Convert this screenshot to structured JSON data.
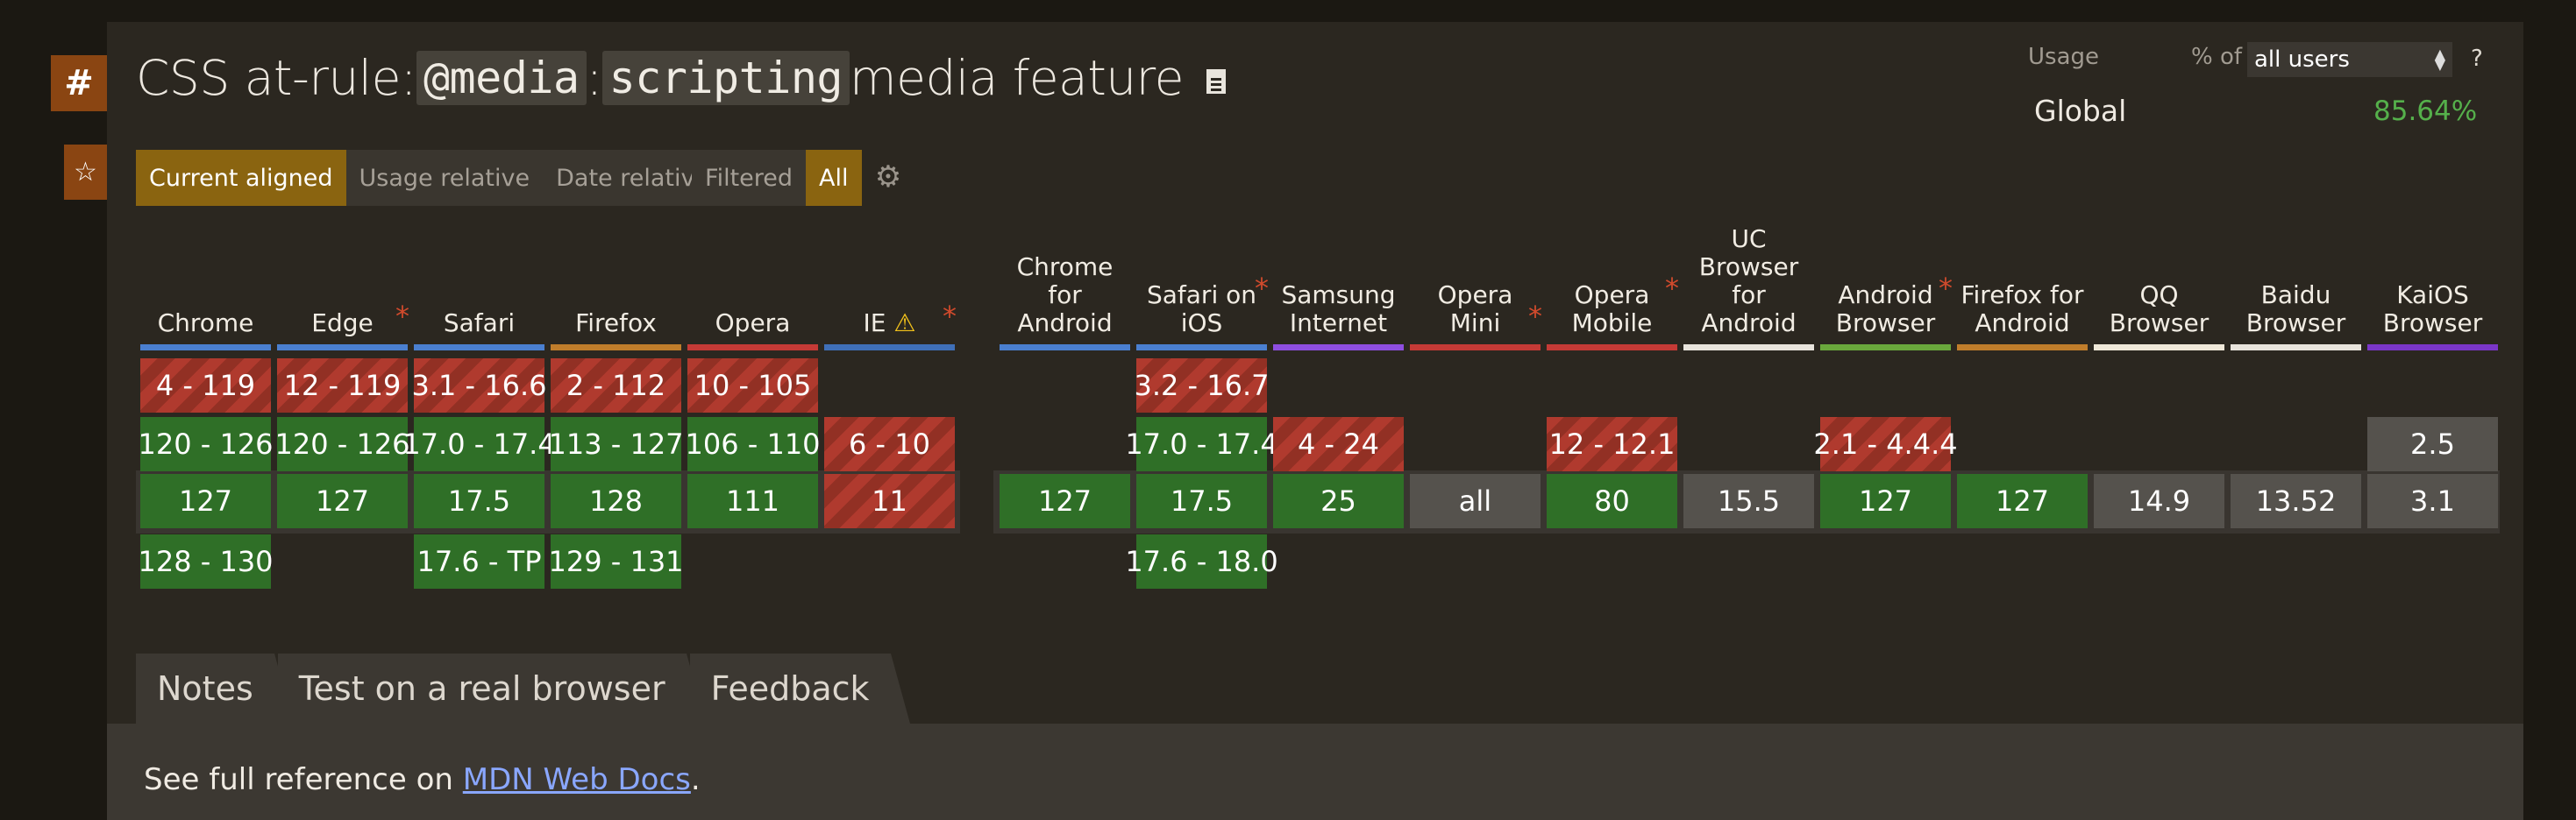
{
  "title": {
    "prefix": "CSS at-rule: ",
    "code1": "@media",
    "sep": ": ",
    "code2": "scripting",
    "suffix": " media feature"
  },
  "anchor_symbol": "#",
  "star_symbol": "☆",
  "usage": {
    "label": "Usage",
    "percent_of": "% of",
    "select_value": "all users",
    "help": "?",
    "region": "Global",
    "value": "85.64%"
  },
  "view_buttons": [
    "Current aligned",
    "Usage relative",
    "Date relative"
  ],
  "filter_buttons": [
    "Filtered",
    "All"
  ],
  "browsers": [
    {
      "id": "chrome",
      "name": "Chrome",
      "asterisk": false,
      "warn": false,
      "bar": "#4a7fd0",
      "cells": [
        {
          "r": 0,
          "v": "4 - 119",
          "s": "n"
        },
        {
          "r": 1,
          "v": "120 - 126",
          "s": "y"
        },
        {
          "r": 2,
          "v": "127",
          "s": "y"
        },
        {
          "r": 3,
          "v": "128 - 130",
          "s": "y"
        }
      ]
    },
    {
      "id": "edge",
      "name": "Edge",
      "asterisk": true,
      "warn": false,
      "bar": "#4a7fd0",
      "cells": [
        {
          "r": 0,
          "v": "12 - 119",
          "s": "n"
        },
        {
          "r": 1,
          "v": "120 - 126",
          "s": "y"
        },
        {
          "r": 2,
          "v": "127",
          "s": "y"
        }
      ]
    },
    {
      "id": "safari",
      "name": "Safari",
      "asterisk": false,
      "warn": false,
      "bar": "#4a7fd0",
      "cells": [
        {
          "r": 0,
          "v": "3.1 - 16.6",
          "s": "n"
        },
        {
          "r": 1,
          "v": "17.0 - 17.4",
          "s": "y"
        },
        {
          "r": 2,
          "v": "17.5",
          "s": "y"
        },
        {
          "r": 3,
          "v": "17.6 - TP",
          "s": "y"
        }
      ]
    },
    {
      "id": "firefox",
      "name": "Firefox",
      "asterisk": false,
      "warn": false,
      "bar": "#c07d2b",
      "cells": [
        {
          "r": 0,
          "v": "2 - 112",
          "s": "n"
        },
        {
          "r": 1,
          "v": "113 - 127",
          "s": "y"
        },
        {
          "r": 2,
          "v": "128",
          "s": "y"
        },
        {
          "r": 3,
          "v": "129 - 131",
          "s": "y"
        }
      ]
    },
    {
      "id": "opera",
      "name": "Opera",
      "asterisk": false,
      "warn": false,
      "bar": "#c53a36",
      "cells": [
        {
          "r": 0,
          "v": "10 - 105",
          "s": "n"
        },
        {
          "r": 1,
          "v": "106 - 110",
          "s": "y"
        },
        {
          "r": 2,
          "v": "111",
          "s": "y"
        }
      ]
    },
    {
      "id": "ie",
      "name": "IE",
      "asterisk": true,
      "warn": true,
      "bar": "#3f6fb8",
      "cells": [
        {
          "r": 1,
          "v": "6 - 10",
          "s": "n"
        },
        {
          "r": 2,
          "v": "11",
          "s": "n"
        }
      ]
    },
    {
      "id": "chrome-android",
      "name": "Chrome for Android",
      "lines": [
        "Chrome",
        "for",
        "Android"
      ],
      "asterisk": false,
      "warn": false,
      "bar": "#4a7fd0",
      "cells": [
        {
          "r": 2,
          "v": "127",
          "s": "y"
        }
      ]
    },
    {
      "id": "safari-ios",
      "name": "Safari on iOS",
      "lines": [
        "Safari on",
        "iOS"
      ],
      "asterisk": true,
      "warn": false,
      "bar": "#4a7fd0",
      "cells": [
        {
          "r": 0,
          "v": "3.2 - 16.7",
          "s": "n"
        },
        {
          "r": 1,
          "v": "17.0 - 17.4",
          "s": "y"
        },
        {
          "r": 2,
          "v": "17.5",
          "s": "y"
        },
        {
          "r": 3,
          "v": "17.6 - 18.0",
          "s": "y"
        }
      ]
    },
    {
      "id": "samsung",
      "name": "Samsung Internet",
      "lines": [
        "Samsung",
        "Internet"
      ],
      "asterisk": false,
      "warn": false,
      "bar": "#8e4ee0",
      "cells": [
        {
          "r": 1,
          "v": "4 - 24",
          "s": "n"
        },
        {
          "r": 2,
          "v": "25",
          "s": "y"
        }
      ]
    },
    {
      "id": "opera-mini",
      "name": "Opera Mini",
      "asterisk": true,
      "warn": false,
      "bar": "#c53a36",
      "cells": [
        {
          "r": 2,
          "v": "all",
          "s": "u"
        }
      ]
    },
    {
      "id": "opera-mobile",
      "name": "Opera Mobile",
      "lines": [
        "Opera",
        "Mobile"
      ],
      "asterisk": true,
      "warn": false,
      "bar": "#c53a36",
      "cells": [
        {
          "r": 1,
          "v": "12 - 12.1",
          "s": "n"
        },
        {
          "r": 2,
          "v": "80",
          "s": "y"
        }
      ]
    },
    {
      "id": "uc",
      "name": "UC Browser for Android",
      "lines": [
        "UC",
        "Browser",
        "for",
        "Android"
      ],
      "asterisk": false,
      "warn": false,
      "bar": "#e8e4dc",
      "cells": [
        {
          "r": 2,
          "v": "15.5",
          "s": "u"
        }
      ]
    },
    {
      "id": "android",
      "name": "Android Browser",
      "lines": [
        "Android",
        "Browser"
      ],
      "asterisk": true,
      "warn": false,
      "bar": "#6aa83c",
      "cells": [
        {
          "r": 1,
          "v": "2.1 - 4.4.4",
          "s": "n"
        },
        {
          "r": 2,
          "v": "127",
          "s": "y"
        }
      ]
    },
    {
      "id": "firefox-android",
      "name": "Firefox for Android",
      "lines": [
        "Firefox for",
        "Android"
      ],
      "asterisk": false,
      "warn": false,
      "bar": "#c07d2b",
      "cells": [
        {
          "r": 2,
          "v": "127",
          "s": "y"
        }
      ]
    },
    {
      "id": "qq",
      "name": "QQ Browser",
      "lines": [
        "QQ",
        "Browser"
      ],
      "asterisk": false,
      "warn": false,
      "bar": "#efe8d8",
      "cells": [
        {
          "r": 2,
          "v": "14.9",
          "s": "u"
        }
      ]
    },
    {
      "id": "baidu",
      "name": "Baidu Browser",
      "lines": [
        "Baidu",
        "Browser"
      ],
      "asterisk": false,
      "warn": false,
      "bar": "#e8e4dc",
      "cells": [
        {
          "r": 2,
          "v": "13.52",
          "s": "u"
        }
      ]
    },
    {
      "id": "kaios",
      "name": "KaiOS Browser",
      "lines": [
        "KaiOS",
        "Browser"
      ],
      "asterisk": false,
      "warn": false,
      "bar": "#7a36c8",
      "cells": [
        {
          "r": 1,
          "v": "2.5",
          "s": "u"
        },
        {
          "r": 2,
          "v": "3.1",
          "s": "u"
        }
      ]
    }
  ],
  "tabs": [
    "Notes",
    "Test on a real browser",
    "Feedback"
  ],
  "notes": {
    "prefix": "See full reference on ",
    "link": "MDN Web Docs",
    "suffix": "."
  },
  "colors": {
    "supported": "#2f6f27",
    "unsupported": "#b03a2e",
    "unknown": "#55524d",
    "accent": "#8a6410",
    "brand": "#8a4512",
    "global_value": "#55b04b"
  }
}
